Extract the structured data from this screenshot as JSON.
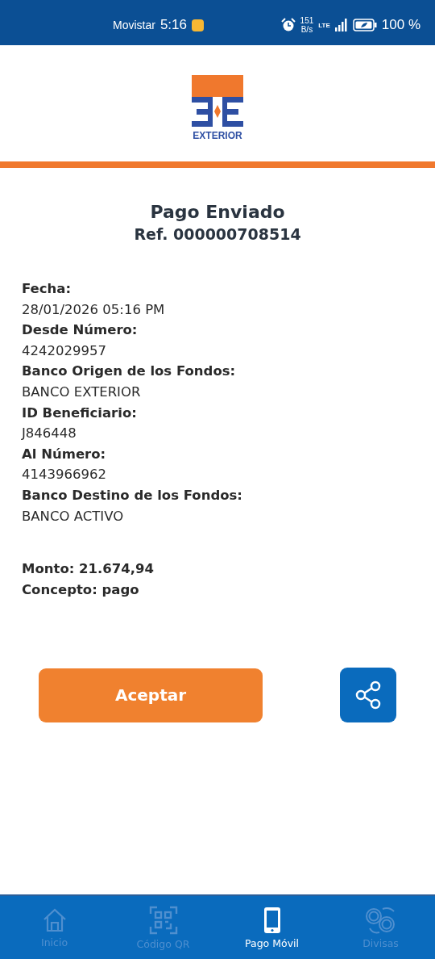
{
  "status_bar": {
    "carrier": "Movistar",
    "time": "5:16",
    "speed_value": "151",
    "speed_unit": "B/s",
    "network": "LTE",
    "battery": "100 %"
  },
  "logo": {
    "name": "EXTERIOR"
  },
  "receipt": {
    "title": "Pago Enviado",
    "reference": "Ref. 000000708514",
    "fields": [
      {
        "label": "Fecha:",
        "value": "28/01/2026 05:16 PM"
      },
      {
        "label": "Desde Número:",
        "value": "4242029957"
      },
      {
        "label": "Banco Origen de los Fondos:",
        "value": "BANCO EXTERIOR"
      },
      {
        "label": "ID Beneficiario:",
        "value": "J846448"
      },
      {
        "label": "Al Número:",
        "value": "4143966962"
      },
      {
        "label": "Banco Destino de los Fondos:",
        "value": "BANCO ACTIVO"
      }
    ],
    "summary": [
      "Monto: 21.674,94",
      "Concepto: pago"
    ]
  },
  "actions": {
    "accept": "Aceptar"
  },
  "bottom_nav": [
    {
      "label": "Inicio",
      "kind": "home",
      "selected": false
    },
    {
      "label": "Código QR",
      "kind": "qr",
      "selected": false
    },
    {
      "label": "Pago Móvil",
      "kind": "phone",
      "selected": true
    },
    {
      "label": "Divisas",
      "kind": "currency",
      "selected": false
    }
  ]
}
